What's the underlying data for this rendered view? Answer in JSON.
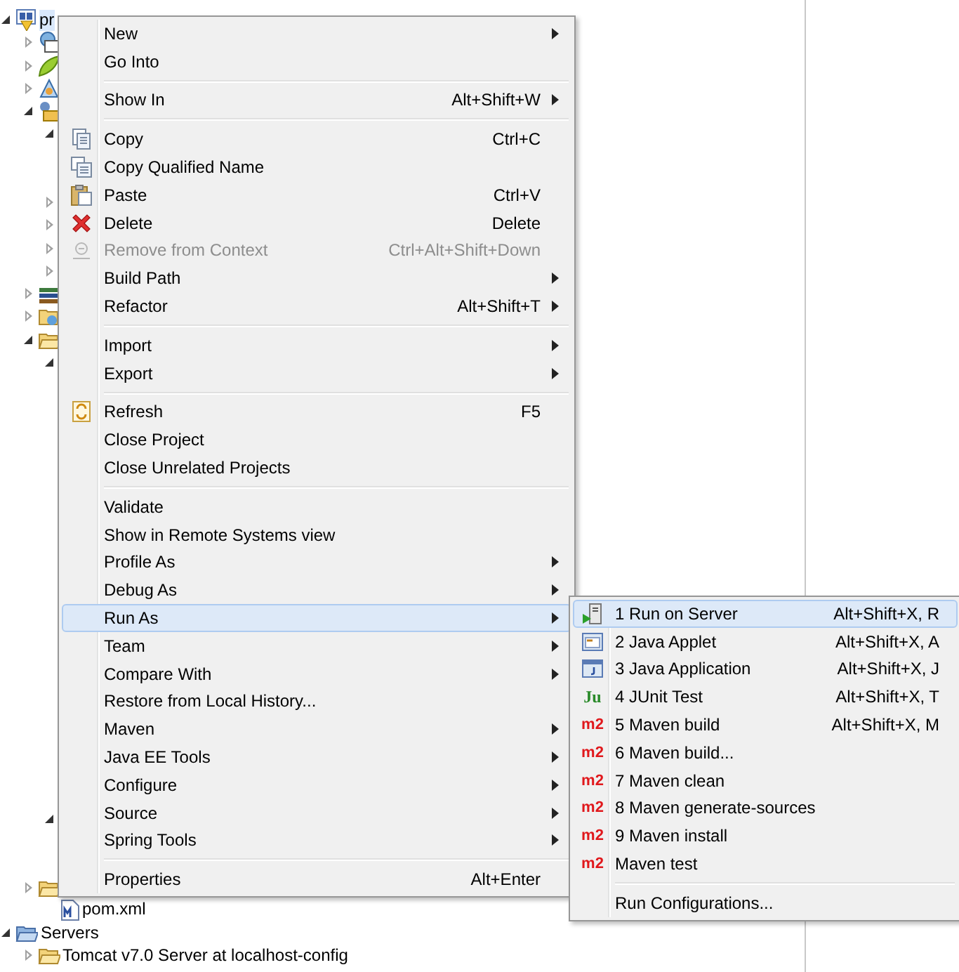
{
  "tree": [
    {
      "kind": "project",
      "label": "pr",
      "expanded": true,
      "selected": true,
      "children": [
        {
          "kind": "deploy",
          "expanded": false
        },
        {
          "kind": "leaf",
          "expanded": false
        },
        {
          "kind": "jaxws",
          "expanded": false
        },
        {
          "kind": "resources",
          "expanded": true,
          "children": [
            {
              "expanded": true,
              "children": [
                {
                  "covered": true
                },
                {
                  "covered": true
                }
              ]
            },
            {
              "expanded": false
            },
            {
              "expanded": false
            },
            {
              "expanded": false
            },
            {
              "expanded": false
            }
          ]
        },
        {
          "kind": "library",
          "expanded": false
        },
        {
          "kind": "webfolder",
          "expanded": false
        },
        {
          "kind": "folder",
          "expanded": true,
          "children": [
            {
              "expanded": true,
              "children": [
                {
                  "covered": true
                },
                {
                  "covered": true
                },
                {
                  "covered": true
                },
                {
                  "covered": true
                },
                {
                  "covered": true
                },
                {
                  "covered": true
                },
                {
                  "covered": true
                },
                {
                  "covered": true
                },
                {
                  "covered": true
                },
                {
                  "covered": true
                },
                {
                  "covered": true
                },
                {
                  "covered": true
                },
                {
                  "covered": true
                },
                {
                  "covered": true
                },
                {
                  "covered": true
                },
                {
                  "covered": true
                },
                {
                  "covered": true
                },
                {
                  "covered": true
                },
                {
                  "covered": true
                }
              ]
            },
            {
              "expanded": true,
              "children": [
                {
                  "covered": true
                },
                {
                  "covered": true
                }
              ]
            }
          ]
        },
        {
          "kind": "folder",
          "expanded": false
        },
        {
          "kind": "pom",
          "label": "pom.xml"
        }
      ]
    },
    {
      "kind": "servers",
      "label": "Servers",
      "expanded": true,
      "children": [
        {
          "kind": "folder",
          "label": "Tomcat v7.0 Server at localhost-config",
          "expanded": false
        }
      ]
    }
  ],
  "context_menu": [
    {
      "kind": "item",
      "label": "New",
      "submenu": true,
      "disabled": false,
      "selected": false
    },
    {
      "kind": "item",
      "label": "Go Into",
      "submenu": false,
      "disabled": false,
      "selected": false
    },
    {
      "kind": "separator"
    },
    {
      "kind": "item",
      "label": "Show In",
      "shortcut": "Alt+Shift+W",
      "submenu": true,
      "disabled": false,
      "selected": false
    },
    {
      "kind": "separator"
    },
    {
      "kind": "copy",
      "label": "Copy",
      "shortcut": "Ctrl+C",
      "submenu": false,
      "disabled": false,
      "selected": false
    },
    {
      "kind": "copy-qualified",
      "label": "Copy Qualified Name",
      "submenu": false,
      "disabled": false,
      "selected": false
    },
    {
      "kind": "paste",
      "label": "Paste",
      "shortcut": "Ctrl+V",
      "submenu": false,
      "disabled": false,
      "selected": false
    },
    {
      "kind": "delete",
      "label": "Delete",
      "shortcut": "Delete",
      "submenu": false,
      "disabled": false,
      "selected": false
    },
    {
      "kind": "remove",
      "label": "Remove from Context",
      "shortcut": "Ctrl+Alt+Shift+Down",
      "submenu": false,
      "disabled": true,
      "selected": false
    },
    {
      "kind": "item",
      "label": "Build Path",
      "submenu": true,
      "disabled": false,
      "selected": false
    },
    {
      "kind": "item",
      "label": "Refactor",
      "shortcut": "Alt+Shift+T",
      "submenu": true,
      "disabled": false,
      "selected": false
    },
    {
      "kind": "separator"
    },
    {
      "kind": "item",
      "label": "Import",
      "submenu": true,
      "disabled": false,
      "selected": false
    },
    {
      "kind": "item",
      "label": "Export",
      "submenu": true,
      "disabled": false,
      "selected": false
    },
    {
      "kind": "separator"
    },
    {
      "kind": "refresh",
      "label": "Refresh",
      "shortcut": "F5",
      "submenu": false,
      "disabled": false,
      "selected": false
    },
    {
      "kind": "item",
      "label": "Close Project",
      "submenu": false,
      "disabled": false,
      "selected": false
    },
    {
      "kind": "item",
      "label": "Close Unrelated Projects",
      "submenu": false,
      "disabled": false,
      "selected": false
    },
    {
      "kind": "separator"
    },
    {
      "kind": "item",
      "label": "Validate",
      "submenu": false,
      "disabled": false,
      "selected": false
    },
    {
      "kind": "item",
      "label": "Show in Remote Systems view",
      "submenu": false,
      "disabled": false,
      "selected": false
    },
    {
      "kind": "item",
      "label": "Profile As",
      "submenu": true,
      "disabled": false,
      "selected": false
    },
    {
      "kind": "item",
      "label": "Debug As",
      "submenu": true,
      "disabled": false,
      "selected": false
    },
    {
      "kind": "item",
      "label": "Run As",
      "submenu": true,
      "disabled": false,
      "selected": true
    },
    {
      "kind": "item",
      "label": "Team",
      "submenu": true,
      "disabled": false,
      "selected": false
    },
    {
      "kind": "item",
      "label": "Compare With",
      "submenu": true,
      "disabled": false,
      "selected": false
    },
    {
      "kind": "item",
      "label": "Restore from Local History...",
      "submenu": false,
      "disabled": false,
      "selected": false
    },
    {
      "kind": "item",
      "label": "Maven",
      "submenu": true,
      "disabled": false,
      "selected": false
    },
    {
      "kind": "item",
      "label": "Java EE Tools",
      "submenu": true,
      "disabled": false,
      "selected": false
    },
    {
      "kind": "item",
      "label": "Configure",
      "submenu": true,
      "disabled": false,
      "selected": false
    },
    {
      "kind": "item",
      "label": "Source",
      "submenu": true,
      "disabled": false,
      "selected": false
    },
    {
      "kind": "item",
      "label": "Spring Tools",
      "submenu": true,
      "disabled": false,
      "selected": false
    },
    {
      "kind": "separator"
    },
    {
      "kind": "item",
      "label": "Properties",
      "shortcut": "Alt+Enter",
      "submenu": false,
      "disabled": false,
      "selected": false
    }
  ],
  "run_as_menu": [
    {
      "kind": "server",
      "label": "1 Run on Server",
      "shortcut": "Alt+Shift+X, R",
      "selected": true
    },
    {
      "kind": "applet",
      "label": "2 Java Applet",
      "shortcut": "Alt+Shift+X, A",
      "selected": false
    },
    {
      "kind": "application",
      "label": "3 Java Application",
      "shortcut": "Alt+Shift+X, J",
      "selected": false
    },
    {
      "kind": "item",
      "label": "4 JUnit Test",
      "shortcut": "Alt+Shift+X, T",
      "badge": "Ju",
      "selected": false
    },
    {
      "kind": "item",
      "label": "5 Maven build",
      "shortcut": "Alt+Shift+X, M",
      "badge": "m2",
      "selected": false
    },
    {
      "kind": "item",
      "label": "6 Maven build...",
      "badge": "m2",
      "selected": false
    },
    {
      "kind": "item",
      "label": "7 Maven clean",
      "badge": "m2",
      "selected": false
    },
    {
      "kind": "item",
      "label": "8 Maven generate-sources",
      "badge": "m2",
      "selected": false
    },
    {
      "kind": "item",
      "label": "9 Maven install",
      "badge": "m2",
      "selected": false
    },
    {
      "kind": "item",
      "label": "Maven test",
      "badge": "m2",
      "selected": false
    },
    {
      "kind": "separator"
    },
    {
      "kind": "item",
      "label": "Run Configurations...",
      "selected": false
    }
  ]
}
